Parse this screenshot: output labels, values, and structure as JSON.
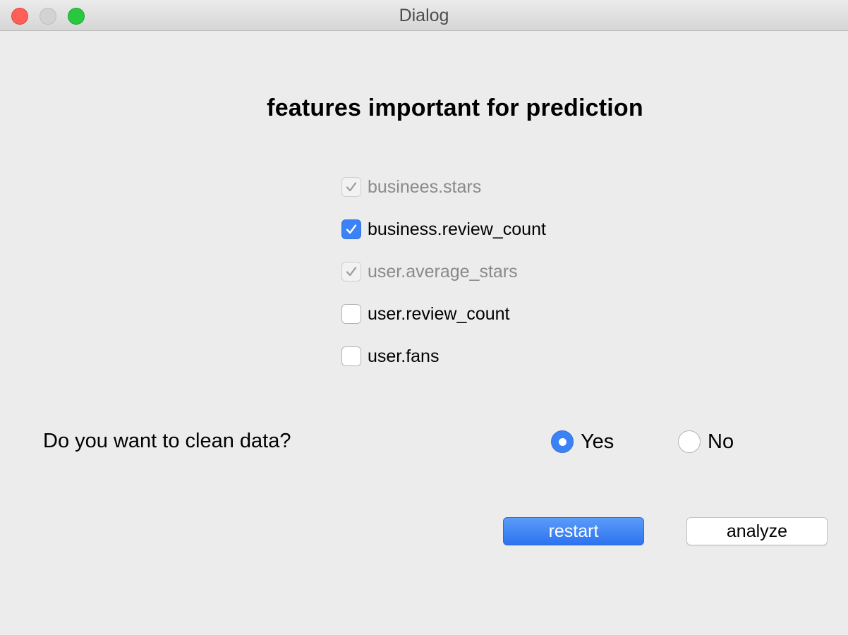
{
  "window": {
    "title": "Dialog"
  },
  "heading": "features important for prediction",
  "features": [
    {
      "label": "businees.stars",
      "checked": true,
      "disabled": true
    },
    {
      "label": "business.review_count",
      "checked": true,
      "disabled": false
    },
    {
      "label": "user.average_stars",
      "checked": true,
      "disabled": true
    },
    {
      "label": "user.review_count",
      "checked": false,
      "disabled": false
    },
    {
      "label": "user.fans",
      "checked": false,
      "disabled": false
    }
  ],
  "clean_data": {
    "question": "Do you want to clean data?",
    "options": [
      {
        "label": "Yes",
        "selected": true
      },
      {
        "label": "No",
        "selected": false
      }
    ]
  },
  "buttons": {
    "restart": "restart",
    "analyze": "analyze"
  },
  "colors": {
    "accent": "#3b82f6",
    "close": "#ff5f57",
    "maximize": "#28c840"
  }
}
